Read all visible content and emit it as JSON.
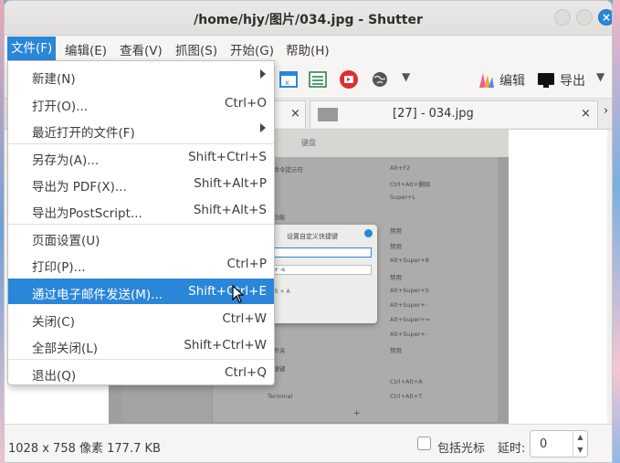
{
  "window": {
    "title": "/home/hjy/图片/034.jpg - Shutter",
    "close_glyph": "×"
  },
  "menubar": [
    {
      "label": "文件(F)"
    },
    {
      "label": "编辑(E)"
    },
    {
      "label": "查看(V)"
    },
    {
      "label": "抓图(S)"
    },
    {
      "label": "开始(G)"
    },
    {
      "label": "帮助(H)"
    }
  ],
  "toolbar": {
    "edit_label": "编辑",
    "export_label": "导出",
    "icons": [
      "window-icon",
      "list-icon",
      "upload-icon",
      "web-icon",
      "dropdown-arrow-icon",
      "edit-icon",
      "export-icon",
      "dropdown-arrow-icon"
    ]
  },
  "tabs": {
    "active_label": "[27] - 034.jpg",
    "close_glyph": "×",
    "scroll_glyph": "›"
  },
  "file_menu": [
    {
      "label": "新建(N)",
      "accel": "",
      "submenu": true
    },
    {
      "label": "打开(O)...",
      "accel": "Ctrl+O"
    },
    {
      "label": "最近打开的文件(F)",
      "accel": "",
      "submenu": true
    },
    {
      "label": "另存为(A)...",
      "accel": "Shift+Ctrl+S"
    },
    {
      "label": "导出为 PDF(X)...",
      "accel": "Shift+Alt+P"
    },
    {
      "label": "导出为PostScript...",
      "accel": "Shift+Alt+S"
    },
    {
      "label": "页面设置(U)",
      "accel": ""
    },
    {
      "label": "打印(P)...",
      "accel": "Ctrl+P"
    },
    {
      "label": "通过电子邮件发送(M)...",
      "accel": "Shift+Ctrl+E"
    },
    {
      "label": "关闭(C)",
      "accel": "Ctrl+W"
    },
    {
      "label": "全部关闭(L)",
      "accel": "Shift+Ctrl+W"
    },
    {
      "label": "退出(Q)",
      "accel": "Ctrl+Q"
    }
  ],
  "preview": {
    "title": "键盘",
    "rows": [
      "行命令提示符",
      "Alt+F2",
      "Ctrl+Alt+删除",
      "Super+L",
      "助功能",
      "禁用",
      "禁用",
      "Alt+Super+8",
      "禁用",
      "Alt+Super+S",
      "Alt+Super+-",
      "Alt+Super+=",
      "Alt+Super+-",
      "禁用",
      "度开关",
      "快捷键",
      "Ctrl+Alt+A",
      "Terminal",
      "Ctrl+Alt+T",
      "+"
    ],
    "dialog": {
      "title": "设置自定义快捷键",
      "name_value": "截图",
      "command_value": "shutter -s",
      "keys": "Ctrl  +  Alt  +  A"
    }
  },
  "status": {
    "info": "1028 x 758 像素  177.7 KB",
    "cursor_label": "包括光标",
    "delay_label": "延时:",
    "delay_value": "0"
  },
  "colors": {
    "accent": "#2a86d9",
    "background": "#f6f5f4"
  }
}
